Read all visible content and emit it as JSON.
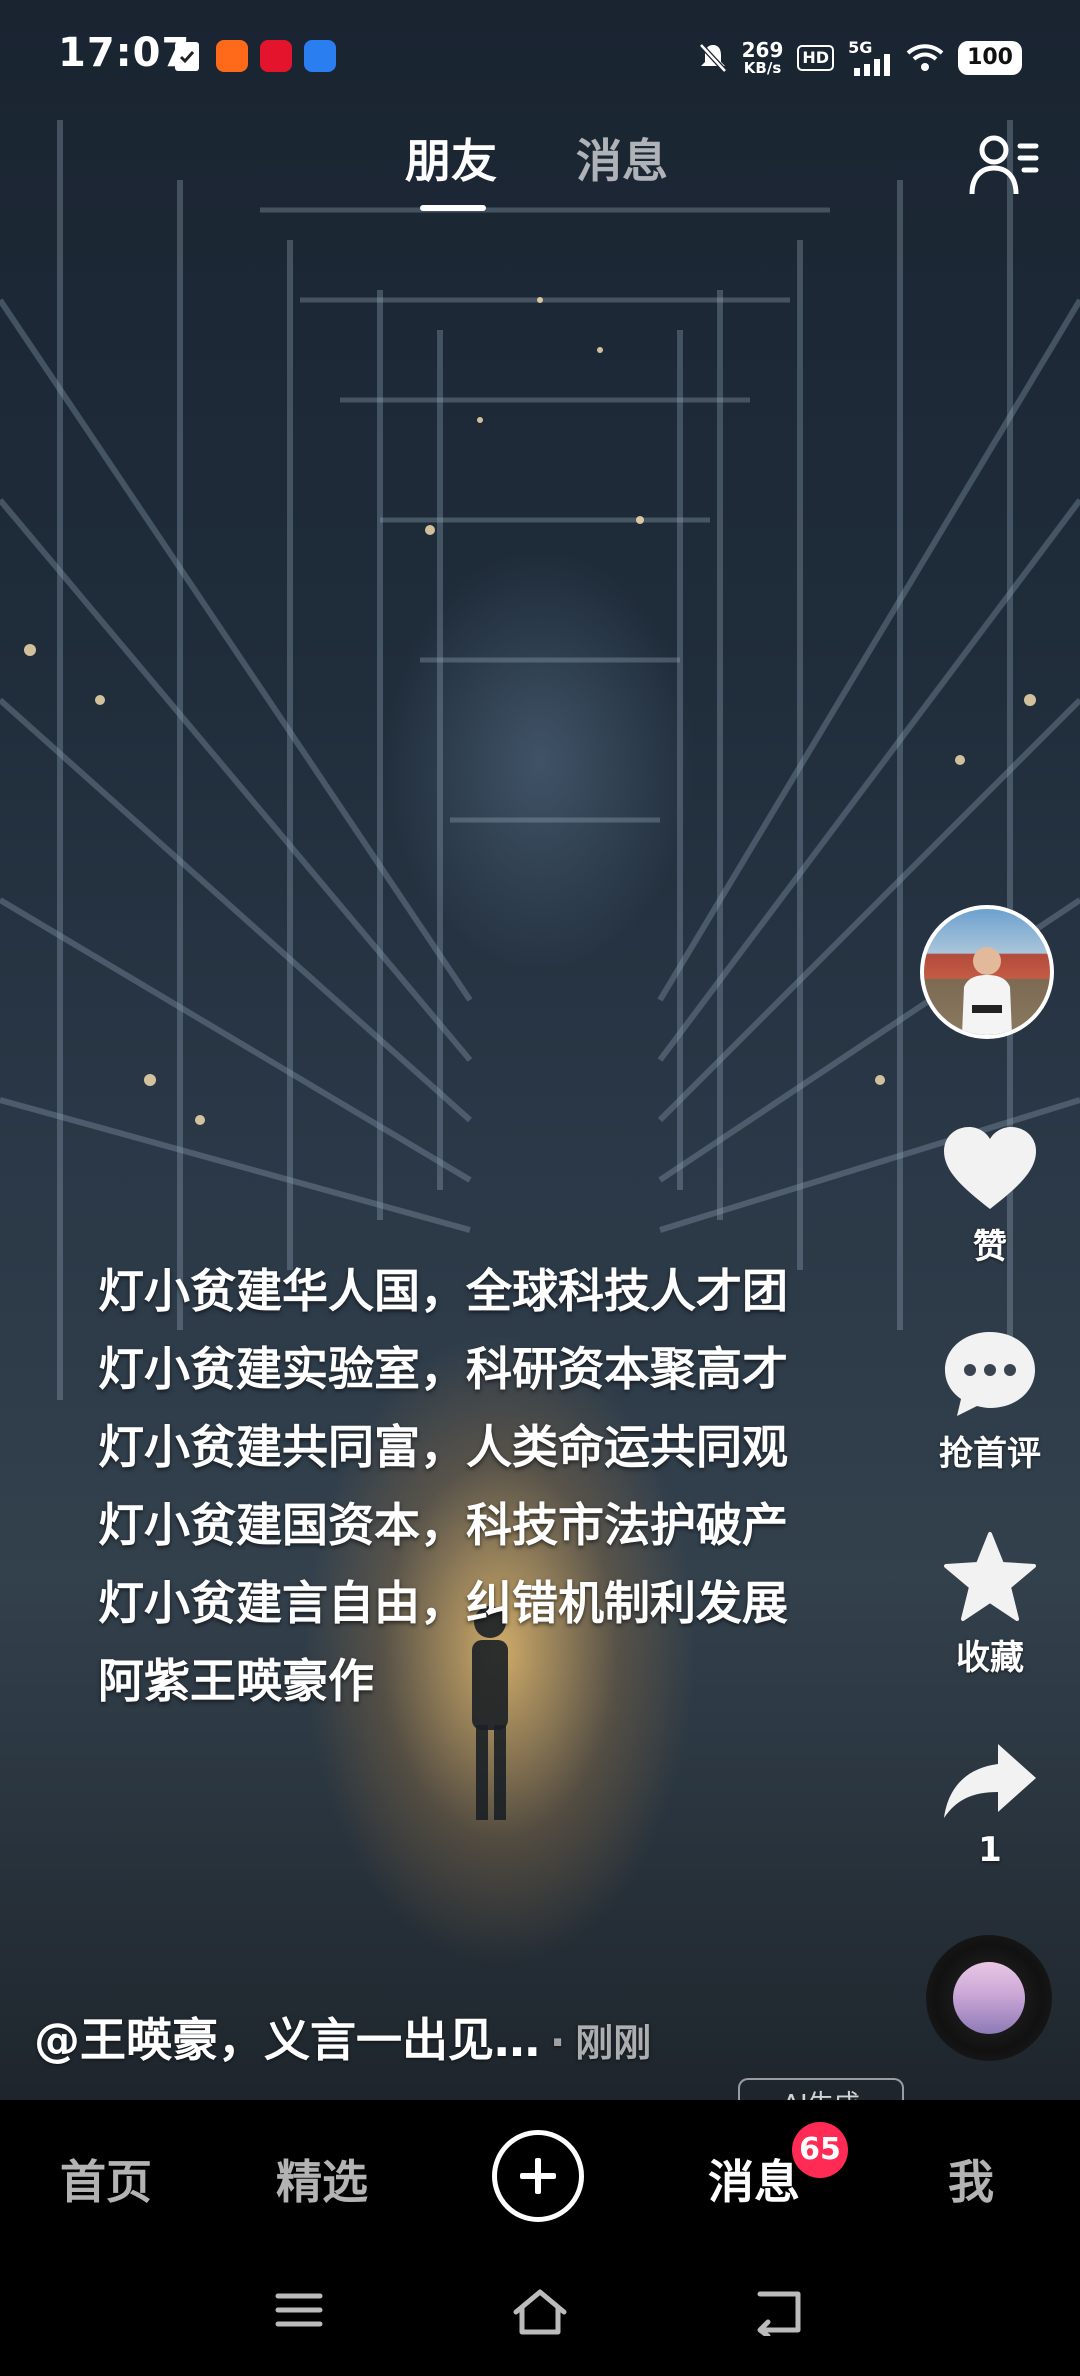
{
  "status_bar": {
    "time": "17:07",
    "net_speed_value": "269",
    "net_speed_unit": "KB/s",
    "hd": "HD",
    "network": "5G",
    "battery": "100",
    "icons": [
      "check-clipboard-icon",
      "app-orange-icon",
      "app-red-heart-icon",
      "app-blue-icon",
      "mute-bell-icon",
      "signal-icon",
      "wifi-icon"
    ]
  },
  "tabs": {
    "friends": "朋友",
    "messages": "消息"
  },
  "poem": {
    "lines": [
      "灯小贫建华人国，全球科技人才团",
      "灯小贫建实验室，科研资本聚高才",
      "灯小贫建共同富，人类命运共同观",
      "灯小贫建国资本，科技市法护破产",
      "灯小贫建言自由，纠错机制利发展",
      "阿紫王暎豪作"
    ]
  },
  "actions": {
    "like": "赞",
    "comment": "抢首评",
    "favorite": "收藏",
    "share_count": "1"
  },
  "caption": {
    "text": "@王暎豪，义言一出见…",
    "separator": "·",
    "time_ago": "刚刚",
    "peek_label": "AI生成"
  },
  "bottom_nav": {
    "home": "首页",
    "featured": "精选",
    "messages": "消息",
    "messages_badge": "65",
    "me": "我"
  },
  "colors": {
    "badge": "#ff2b55",
    "nav_bg": "#000000",
    "scene_glow": "#ebbe6e"
  }
}
